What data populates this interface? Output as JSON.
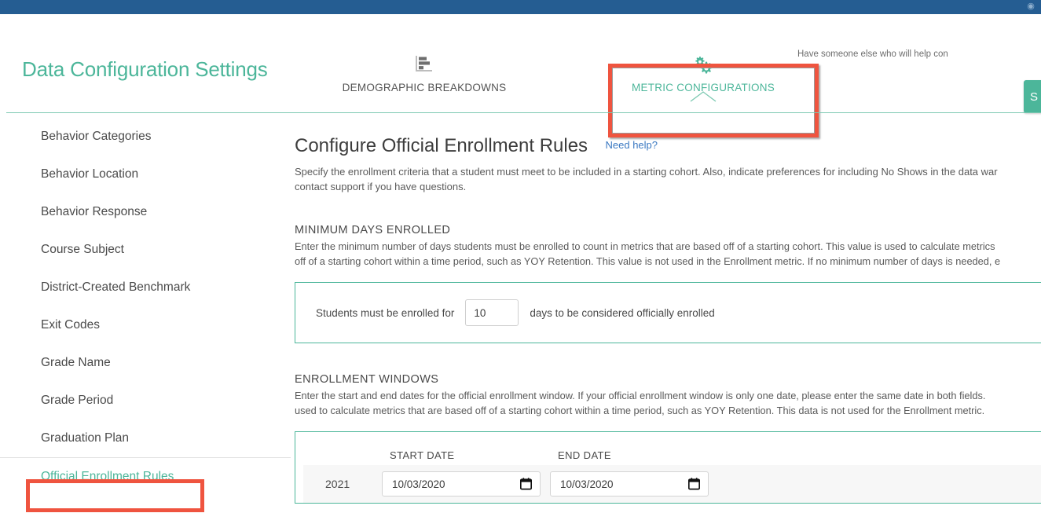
{
  "topbar": {
    "icon": "user-circle-icon"
  },
  "header": {
    "app_title": "Data Configuration Settings",
    "help_text": "Have someone else who will help con",
    "primary_button_label": "S",
    "primary_button_color": "#4cb69a",
    "tabs": [
      {
        "label": "DEMOGRAPHIC BREAKDOWNS",
        "icon": "bar-chart-icon",
        "active": false
      },
      {
        "label": "METRIC CONFIGURATIONS",
        "icon": "gears-icon",
        "active": true
      }
    ]
  },
  "sidebar": {
    "items": [
      {
        "label": "Behavior Categories",
        "active": false
      },
      {
        "label": "Behavior Location",
        "active": false
      },
      {
        "label": "Behavior Response",
        "active": false
      },
      {
        "label": "Course Subject",
        "active": false
      },
      {
        "label": "District-Created Benchmark",
        "active": false
      },
      {
        "label": "Exit Codes",
        "active": false
      },
      {
        "label": "Grade Name",
        "active": false
      },
      {
        "label": "Grade Period",
        "active": false
      },
      {
        "label": "Graduation Plan",
        "active": false
      },
      {
        "label": "Official Enrollment Rules",
        "active": true
      }
    ]
  },
  "main": {
    "page_title": "Configure Official Enrollment Rules",
    "need_help_label": "Need help?",
    "intro_line1": "Specify the enrollment criteria that a student must meet to be included in a starting cohort. Also, indicate preferences for including No Shows in the data war",
    "intro_line2": "contact support if you have questions.",
    "minimum_days": {
      "section_title": "MINIMUM DAYS ENROLLED",
      "desc_line1": "Enter the minimum number of days students must be enrolled to count in metrics that are based off of a starting cohort. This value is used to calculate metrics",
      "desc_line2": "off of a starting cohort within a time period, such as YOY Retention. This value is not used in the Enrollment metric. If no minimum number of days is needed, е",
      "prefix_label": "Students must be enrolled for",
      "value": "10",
      "suffix_label": "days to be considered officially enrolled"
    },
    "enrollment_windows": {
      "section_title": "ENROLLMENT WINDOWS",
      "desc_line1": "Enter the start and end dates for the official enrollment window. If your official enrollment window is only one date, please enter the same date in both fields.",
      "desc_line2": "used to calculate metrics that are based off of a starting cohort within a time period, such as YOY Retention. This data is not used for the Enrollment metric.",
      "columns": {
        "year": "",
        "start_date": "START DATE",
        "end_date": "END DATE"
      },
      "rows": [
        {
          "year": "2021",
          "start_date": "10/03/2020",
          "end_date": "10/03/2020"
        }
      ]
    }
  },
  "annotations": {
    "highlight_color": "#ef543f",
    "boxes": [
      "metric-configurations-tab",
      "official-enrollment-rules-sidebar-item"
    ]
  }
}
